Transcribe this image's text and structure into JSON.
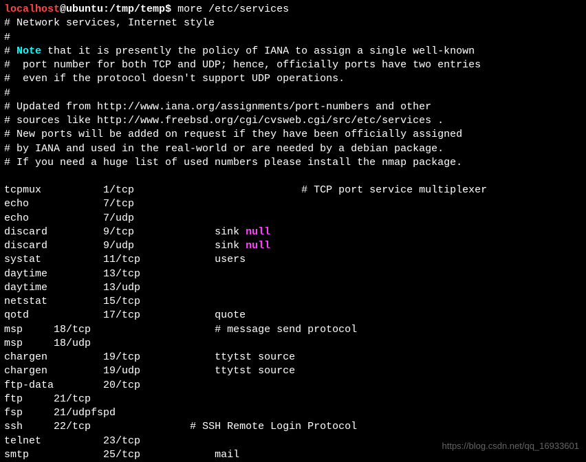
{
  "prompt": {
    "user": "localhost",
    "separator": "@",
    "host": "ubuntu",
    "path": ":/tmp/temp",
    "symbol": "$ ",
    "command": "more /etc/services"
  },
  "header_lines": [
    "# Network services, Internet style",
    "#",
    "#",
    "#  port number for both TCP and UDP; hence, officially ports have two entries",
    "#  even if the protocol doesn't support UDP operations.",
    "#",
    "# Updated from http://www.iana.org/assignments/port-numbers and other",
    "# sources like http://www.freebsd.org/cgi/cvsweb.cgi/src/etc/services .",
    "# New ports will be added on request if they have been officially assigned",
    "# by IANA and used in the real-world or are needed by a debian package.",
    "# If you need a huge list of used numbers please install the nmap package."
  ],
  "note_line": {
    "prefix": "# ",
    "note_word": "Note",
    "suffix": " that it is presently the policy of IANA to assign a single well-known"
  },
  "services": [
    {
      "name": "tcpmux",
      "port": "1/tcp",
      "extra": "",
      "keyword": "",
      "comment": "# TCP port service multiplexer",
      "col1": 16,
      "col2": 18
    },
    {
      "name": "echo",
      "port": "7/tcp",
      "extra": "",
      "keyword": "",
      "comment": "",
      "col1": 16,
      "col2": 18
    },
    {
      "name": "echo",
      "port": "7/udp",
      "extra": "",
      "keyword": "",
      "comment": "",
      "col1": 16,
      "col2": 18
    },
    {
      "name": "discard",
      "port": "9/tcp",
      "extra": "sink ",
      "keyword": "null",
      "comment": "",
      "col1": 16,
      "col2": 18
    },
    {
      "name": "discard",
      "port": "9/udp",
      "extra": "sink ",
      "keyword": "null",
      "comment": "",
      "col1": 16,
      "col2": 18
    },
    {
      "name": "systat",
      "port": "11/tcp",
      "extra": "users",
      "keyword": "",
      "comment": "",
      "col1": 16,
      "col2": 18
    },
    {
      "name": "daytime",
      "port": "13/tcp",
      "extra": "",
      "keyword": "",
      "comment": "",
      "col1": 16,
      "col2": 18
    },
    {
      "name": "daytime",
      "port": "13/udp",
      "extra": "",
      "keyword": "",
      "comment": "",
      "col1": 16,
      "col2": 18
    },
    {
      "name": "netstat",
      "port": "15/tcp",
      "extra": "",
      "keyword": "",
      "comment": "",
      "col1": 16,
      "col2": 18
    },
    {
      "name": "qotd",
      "port": "17/tcp",
      "extra": "quote",
      "keyword": "",
      "comment": "",
      "col1": 16,
      "col2": 18
    },
    {
      "name": "msp",
      "port": "18/tcp",
      "extra": "",
      "keyword": "",
      "comment": "# message send protocol",
      "col1": 8,
      "col2": 18
    },
    {
      "name": "msp",
      "port": "18/udp",
      "extra": "",
      "keyword": "",
      "comment": "",
      "col1": 8,
      "col2": 18
    },
    {
      "name": "chargen",
      "port": "19/tcp",
      "extra": "ttytst source",
      "keyword": "",
      "comment": "",
      "col1": 16,
      "col2": 18
    },
    {
      "name": "chargen",
      "port": "19/udp",
      "extra": "ttytst source",
      "keyword": "",
      "comment": "",
      "col1": 16,
      "col2": 18
    },
    {
      "name": "ftp-data",
      "port": "20/tcp",
      "extra": "",
      "keyword": "",
      "comment": "",
      "col1": 16,
      "col2": 18
    },
    {
      "name": "ftp",
      "port": "21/tcp",
      "extra": "",
      "keyword": "",
      "comment": "",
      "col1": 8,
      "col2": 18
    },
    {
      "name": "fsp",
      "port": "21/udp",
      "extra": "fspd",
      "keyword": "",
      "comment": "",
      "col1": 8,
      "col2": 5
    },
    {
      "name": "ssh",
      "port": "22/tcp",
      "extra": "",
      "keyword": "",
      "comment": "# SSH Remote Login Protocol",
      "col1": 8,
      "col2": 18
    },
    {
      "name": "telnet",
      "port": "23/tcp",
      "extra": "",
      "keyword": "",
      "comment": "",
      "col1": 16,
      "col2": 18
    },
    {
      "name": "smtp",
      "port": "25/tcp",
      "extra": "mail",
      "keyword": "",
      "comment": "",
      "col1": 16,
      "col2": 18
    }
  ],
  "watermark": "https://blog.csdn.net/qq_16933601"
}
